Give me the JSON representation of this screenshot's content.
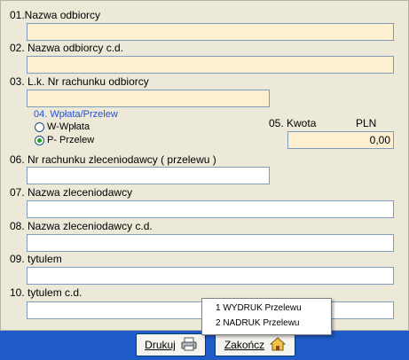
{
  "form": {
    "f01": {
      "label": "01.Nazwa odbiorcy",
      "value": ""
    },
    "f02": {
      "label": "02. Nazwa odbiorcy c.d.",
      "value": ""
    },
    "f03": {
      "label": "03. L.k. Nr rachunku odbiorcy",
      "value": ""
    },
    "f04": {
      "label": "04. Wpłata/Przelew",
      "options": [
        {
          "label": "W-Wpłata",
          "selected": false
        },
        {
          "label": "P- Przelew",
          "selected": true
        }
      ]
    },
    "f05": {
      "label": "05. Kwota",
      "currency": "PLN",
      "value": "0,00"
    },
    "f06": {
      "label": "06. Nr rachunku zleceniodawcy ( przelewu )",
      "value": ""
    },
    "f07": {
      "label": "07. Nazwa zleceniodawcy",
      "value": ""
    },
    "f08": {
      "label": "08. Nazwa zleceniodawcy c.d.",
      "value": ""
    },
    "f09": {
      "label": "09. tytulem",
      "value": ""
    },
    "f10": {
      "label": "10. tytulem c.d.",
      "value": ""
    }
  },
  "buttons": {
    "print": {
      "label": "Drukuj",
      "icon": "printer-icon"
    },
    "close": {
      "label": "Zakończ",
      "icon": "home-exit-icon"
    }
  },
  "print_menu": {
    "items": [
      {
        "label": "1  WYDRUK  Przelewu"
      },
      {
        "label": "2  NADRUK  Przelewu"
      }
    ]
  },
  "colors": {
    "field_highlight": "#fcefd2",
    "bottom_bar": "#1f5bc8",
    "group_label": "#2350d8",
    "radio_selected": "#21a121"
  }
}
